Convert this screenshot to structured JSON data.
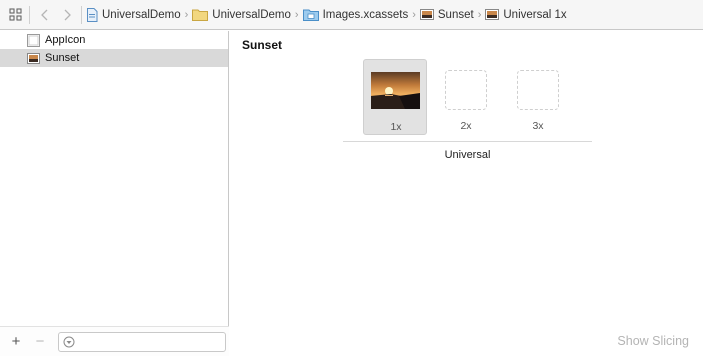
{
  "jumpbar": {
    "breadcrumbs": [
      {
        "label": "UniversalDemo",
        "icon": "project-file-icon"
      },
      {
        "label": "UniversalDemo",
        "icon": "folder-icon"
      },
      {
        "label": "Images.xcassets",
        "icon": "asset-catalog-icon"
      },
      {
        "label": "Sunset",
        "icon": "image-set-icon"
      },
      {
        "label": "Universal 1x",
        "icon": "image-set-icon"
      }
    ]
  },
  "navigator": {
    "items": [
      {
        "label": "AppIcon",
        "icon": "app-icon-set-icon",
        "selected": false
      },
      {
        "label": "Sunset",
        "icon": "image-set-icon",
        "selected": true
      }
    ],
    "filter_placeholder": ""
  },
  "editor": {
    "title": "Sunset",
    "slots": [
      {
        "label": "1x",
        "filled": true
      },
      {
        "label": "2x",
        "filled": false
      },
      {
        "label": "3x",
        "filled": false
      }
    ],
    "idiom": "Universal",
    "show_slicing_label": "Show Slicing"
  },
  "colors": {
    "selection": "#d9d9d9",
    "folder": "#e8c766",
    "asset_catalog": "#5a9fd4"
  }
}
